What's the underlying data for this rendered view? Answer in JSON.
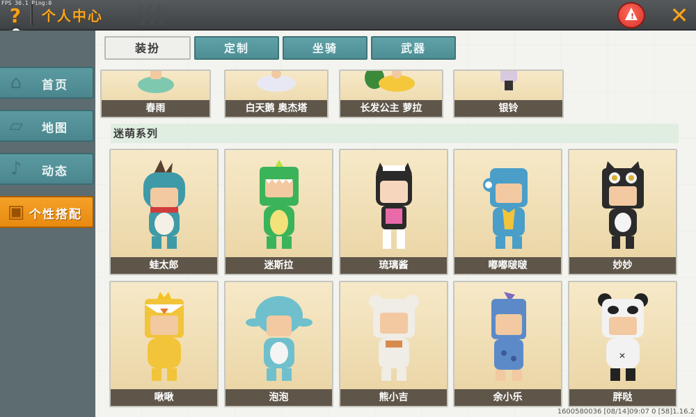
{
  "status": {
    "fps": "FPS 30.1  Ping:0"
  },
  "header": {
    "title": "个人中心",
    "help_icon": "question-icon",
    "warn_icon": "warning-icon",
    "close_icon": "close-icon"
  },
  "sidebar": {
    "items": [
      {
        "label": "首页",
        "icon": "home-icon",
        "active": false
      },
      {
        "label": "地图",
        "icon": "map-icon",
        "active": false
      },
      {
        "label": "动态",
        "icon": "bell-icon",
        "active": false
      },
      {
        "label": "个性搭配",
        "icon": "outfit-icon",
        "active": true
      }
    ]
  },
  "tabs": [
    {
      "label": "装扮",
      "active": true
    },
    {
      "label": "定制",
      "active": false
    },
    {
      "label": "坐骑",
      "active": false
    },
    {
      "label": "武器",
      "active": false
    }
  ],
  "top_row": [
    {
      "name": "春雨",
      "color": "#7ec8b0"
    },
    {
      "name": "白天鹅 奥杰塔",
      "color": "#e8e8f4"
    },
    {
      "name": "长发公主 萝拉",
      "color": "#f4c83a"
    },
    {
      "name": "银铃",
      "color": "#d8c8e0"
    }
  ],
  "section": {
    "title": "迷萌系列"
  },
  "cards_row1": [
    {
      "name": "蛙太郎",
      "color": "#3f9aa8"
    },
    {
      "name": "迷斯拉",
      "color": "#3bb35a"
    },
    {
      "name": "琉璃酱",
      "color": "#2a2a2a"
    },
    {
      "name": "嘟嘟啵啵",
      "color": "#4a9ec8"
    },
    {
      "name": "妙妙",
      "color": "#2b2b2b"
    }
  ],
  "cards_row2": [
    {
      "name": "啾啾",
      "color": "#f2c43a"
    },
    {
      "name": "泡泡",
      "color": "#6fc0cc"
    },
    {
      "name": "熊小吉",
      "color": "#f0ece6"
    },
    {
      "name": "余小乐",
      "color": "#5c8ac8"
    },
    {
      "name": "胖哒",
      "color": "#f2f2f2"
    }
  ],
  "footer": {
    "info": "1600580036  [08/14]09:07 0  [58]1.16.2"
  }
}
